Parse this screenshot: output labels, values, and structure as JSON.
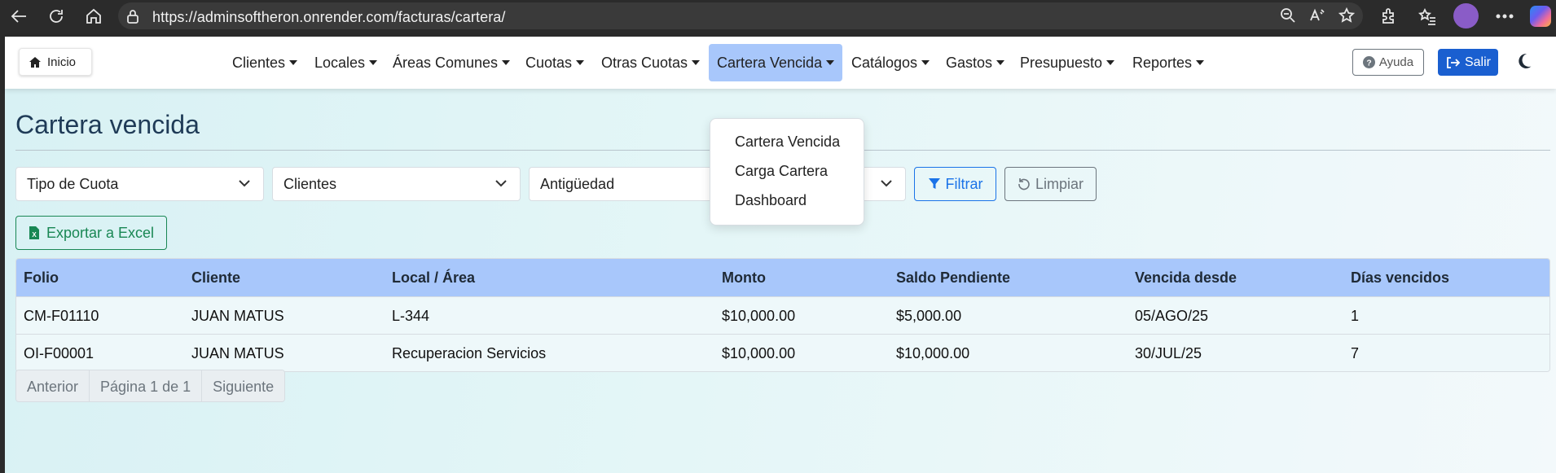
{
  "browser": {
    "url": "https://adminsoftheron.onrender.com/facturas/cartera/"
  },
  "navbar": {
    "home_label": "Inicio",
    "menu": [
      {
        "label": "Clientes"
      },
      {
        "label": "Locales"
      },
      {
        "label": "Áreas Comunes"
      },
      {
        "label": "Cuotas"
      },
      {
        "label": "Otras Cuotas"
      },
      {
        "label": "Cartera Vencida",
        "active": true
      },
      {
        "label": "Catálogos"
      },
      {
        "label": "Gastos"
      },
      {
        "label": "Presupuesto"
      },
      {
        "label": "Reportes"
      }
    ],
    "help_label": "Ayuda",
    "logout_label": "Salir",
    "active_color": "#a8c7fb",
    "primary_color": "#1a5fd0"
  },
  "dropdown": {
    "items": [
      "Cartera Vencida",
      "Carga Cartera",
      "Dashboard"
    ]
  },
  "page": {
    "title": "Cartera vencida"
  },
  "filters": {
    "tipo_cuota": "Tipo de Cuota",
    "clientes": "Clientes",
    "antiguedad": "Antigüedad",
    "filter_label": "Filtrar",
    "clear_label": "Limpiar"
  },
  "export_label": "Exportar a Excel",
  "table": {
    "columns": [
      "Folio",
      "Cliente",
      "Local / Área",
      "Monto",
      "Saldo Pendiente",
      "Vencida desde",
      "Días vencidos"
    ],
    "rows": [
      [
        "CM-F01110",
        "JUAN MATUS",
        "L-344",
        "$10,000.00",
        "$5,000.00",
        "05/AGO/25",
        "1"
      ],
      [
        "OI-F00001",
        "JUAN MATUS",
        "Recuperacion Servicios",
        "$10,000.00",
        "$10,000.00",
        "30/JUL/25",
        "7"
      ]
    ]
  },
  "pagination": {
    "prev": "Anterior",
    "page": "Página 1 de 1",
    "next": "Siguiente"
  }
}
